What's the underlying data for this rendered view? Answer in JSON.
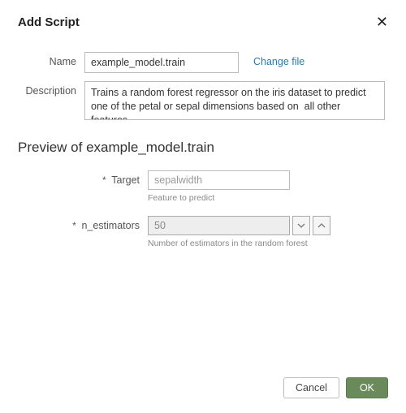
{
  "dialog": {
    "title": "Add Script",
    "close_label": "✕"
  },
  "form": {
    "name_label": "Name",
    "name_value": "example_model.train",
    "change_file_label": "Change file",
    "description_label": "Description",
    "description_value": "Trains a random forest regressor on the iris dataset to predict one of the petal or sepal dimensions based on  all other features"
  },
  "preview": {
    "heading": "Preview of example_model.train",
    "params": {
      "target": {
        "label": "Target",
        "value": "sepalwidth",
        "help": "Feature to predict",
        "required_marker": "*"
      },
      "n_estimators": {
        "label": "n_estimators",
        "value": "50",
        "help": "Number of estimators in the random forest",
        "required_marker": "*"
      }
    }
  },
  "footer": {
    "cancel_label": "Cancel",
    "ok_label": "OK"
  }
}
